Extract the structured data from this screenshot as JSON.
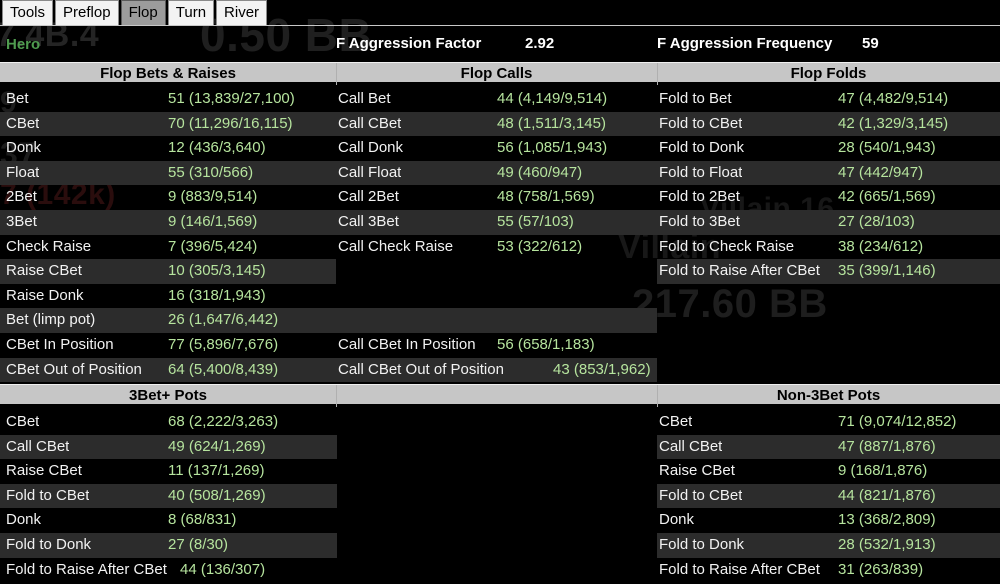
{
  "window": {
    "tabs": [
      {
        "label": "Tools",
        "active": false
      },
      {
        "label": "Preflop",
        "active": false
      },
      {
        "label": "Flop",
        "active": true
      },
      {
        "label": "Turn",
        "active": false
      },
      {
        "label": "River",
        "active": false
      }
    ]
  },
  "header": {
    "player": "Hero",
    "aggression_factor_label": "F Aggression Factor",
    "aggression_factor_value": "2.92",
    "aggression_frequency_label": "F Aggression Frequency",
    "aggression_frequency_value": "59"
  },
  "colors": {
    "value_green": "#b6e49e",
    "label_white": "#f2f2f2",
    "hero_green": "#4f9c4f",
    "stripe": "#2c2c2c",
    "header_grey": "#c6c6c6",
    "background": "#000000"
  },
  "ghost_text": [
    {
      "text": "7.4B.4"
    },
    {
      "text": "0.50 BB"
    },
    {
      "text": "9"
    },
    {
      "text": "37"
    },
    {
      "text": "7 (142k)"
    },
    {
      "text": "Villain 16"
    },
    {
      "text": "217.60 BB"
    },
    {
      "text": "Villain"
    }
  ],
  "section_flop": {
    "headers": [
      {
        "label": "Flop Bets & Raises"
      },
      {
        "label": "Flop Calls"
      },
      {
        "label": "Flop Folds"
      }
    ],
    "rows": [
      {
        "bets": {
          "label": "Bet",
          "value": "51 (13,839/27,100)"
        },
        "calls": {
          "label": "Call Bet",
          "value": "44 (4,149/9,514)"
        },
        "folds": {
          "label": "Fold to Bet",
          "value": "47 (4,482/9,514)"
        }
      },
      {
        "bets": {
          "label": "CBet",
          "value": "70 (11,296/16,115)"
        },
        "calls": {
          "label": "Call CBet",
          "value": "48 (1,511/3,145)"
        },
        "folds": {
          "label": "Fold to CBet",
          "value": "42 (1,329/3,145)"
        }
      },
      {
        "bets": {
          "label": "Donk",
          "value": "12 (436/3,640)"
        },
        "calls": {
          "label": "Call Donk",
          "value": "56 (1,085/1,943)"
        },
        "folds": {
          "label": "Fold to Donk",
          "value": "28 (540/1,943)"
        }
      },
      {
        "bets": {
          "label": "Float",
          "value": "55 (310/566)"
        },
        "calls": {
          "label": "Call Float",
          "value": "49 (460/947)"
        },
        "folds": {
          "label": "Fold to Float",
          "value": "47 (442/947)"
        }
      },
      {
        "bets": {
          "label": "2Bet",
          "value": "9 (883/9,514)"
        },
        "calls": {
          "label": "Call 2Bet",
          "value": "48 (758/1,569)"
        },
        "folds": {
          "label": "Fold to 2Bet",
          "value": "42 (665/1,569)"
        }
      },
      {
        "bets": {
          "label": "3Bet",
          "value": "9 (146/1,569)"
        },
        "calls": {
          "label": "Call 3Bet",
          "value": "55 (57/103)"
        },
        "folds": {
          "label": "Fold to 3Bet",
          "value": "27 (28/103)"
        }
      },
      {
        "bets": {
          "label": "Check Raise",
          "value": "7 (396/5,424)"
        },
        "calls": {
          "label": "Call Check Raise",
          "value": "53 (322/612)"
        },
        "folds": {
          "label": "Fold to Check Raise",
          "value": "38 (234/612)"
        }
      },
      {
        "bets": {
          "label": "Raise CBet",
          "value": "10 (305/3,145)"
        },
        "calls": {
          "label": "",
          "value": ""
        },
        "folds": {
          "label": "Fold to Raise After CBet",
          "value": "35 (399/1,146)"
        }
      },
      {
        "bets": {
          "label": "Raise Donk",
          "value": "16 (318/1,943)"
        },
        "calls": {
          "label": "",
          "value": ""
        },
        "folds": {
          "label": "",
          "value": ""
        }
      },
      {
        "bets": {
          "label": "Bet (limp pot)",
          "value": "26 (1,647/6,442)"
        },
        "calls": {
          "label": "",
          "value": ""
        },
        "folds": {
          "label": "",
          "value": ""
        }
      },
      {
        "bets": {
          "label": "CBet In Position",
          "value": "77 (5,896/7,676)"
        },
        "calls": {
          "label": "Call CBet In Position",
          "value": "56 (658/1,183)"
        },
        "folds": {
          "label": "",
          "value": ""
        }
      },
      {
        "bets": {
          "label": "CBet Out of Position",
          "value": "64 (5,400/8,439)"
        },
        "calls": {
          "label": "Call CBet Out of Position",
          "value": "43 (853/1,962)"
        },
        "folds": {
          "label": "",
          "value": ""
        }
      }
    ]
  },
  "section_pots": {
    "headers": [
      {
        "label": "3Bet+ Pots"
      },
      {
        "label": "Non-3Bet Pots"
      }
    ],
    "rows": [
      {
        "threebet": {
          "label": "CBet",
          "value": "68 (2,222/3,263)"
        },
        "nonthree": {
          "label": "CBet",
          "value": "71 (9,074/12,852)"
        }
      },
      {
        "threebet": {
          "label": "Call CBet",
          "value": "49 (624/1,269)"
        },
        "nonthree": {
          "label": "Call CBet",
          "value": "47 (887/1,876)"
        }
      },
      {
        "threebet": {
          "label": "Raise CBet",
          "value": "11 (137/1,269)"
        },
        "nonthree": {
          "label": "Raise CBet",
          "value": "9 (168/1,876)"
        }
      },
      {
        "threebet": {
          "label": "Fold to CBet",
          "value": "40 (508/1,269)"
        },
        "nonthree": {
          "label": "Fold to CBet",
          "value": "44 (821/1,876)"
        }
      },
      {
        "threebet": {
          "label": "Donk",
          "value": "8 (68/831)"
        },
        "nonthree": {
          "label": "Donk",
          "value": "13 (368/2,809)"
        }
      },
      {
        "threebet": {
          "label": "Fold to Donk",
          "value": "27 (8/30)"
        },
        "nonthree": {
          "label": "Fold to Donk",
          "value": "28 (532/1,913)"
        }
      },
      {
        "threebet": {
          "label": "Fold to Raise After CBet",
          "value": "44 (136/307)"
        },
        "nonthree": {
          "label": "Fold to Raise After CBet",
          "value": "31 (263/839)"
        }
      }
    ]
  }
}
